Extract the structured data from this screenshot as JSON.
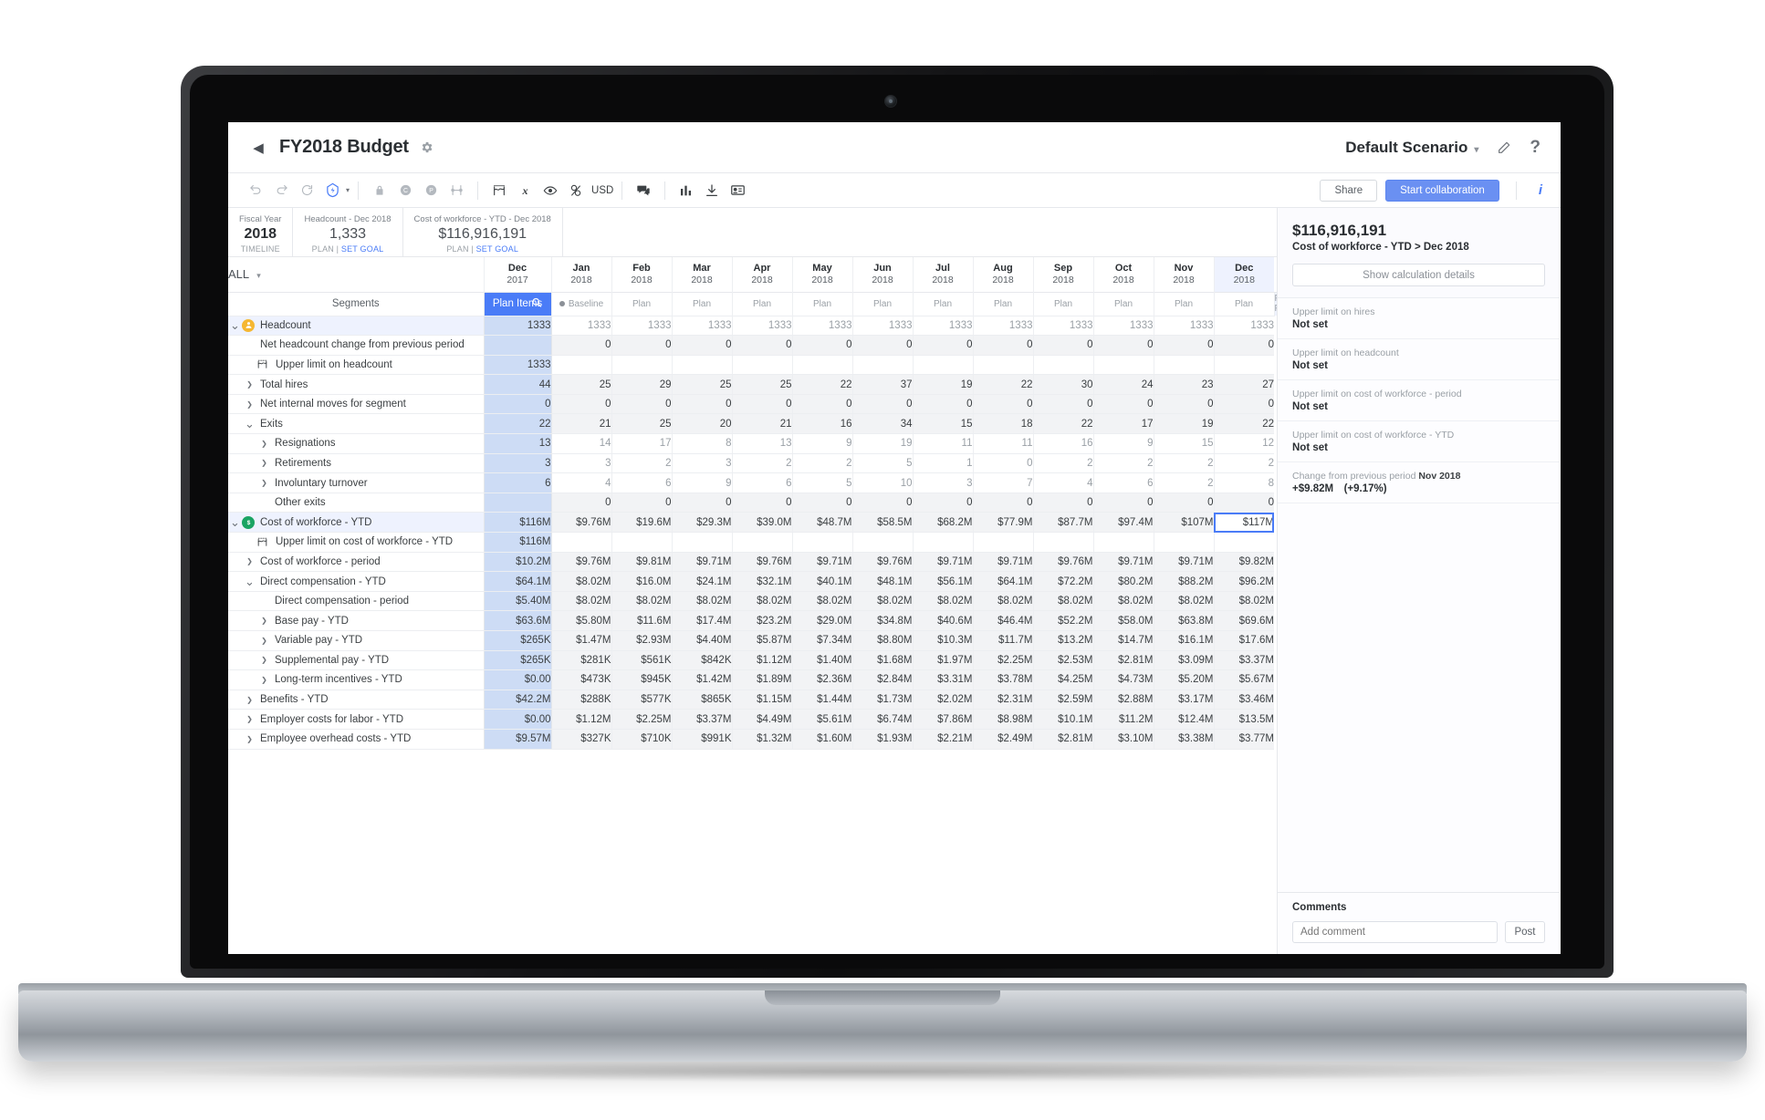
{
  "titlebar": {
    "back_icon": "back-caret-icon",
    "title": "FY2018 Budget",
    "gear_icon": "gear-icon",
    "scenario": "Default Scenario",
    "scenario_caret": "chevron-down-icon",
    "edit_icon": "pencil-icon",
    "help_icon": "?"
  },
  "toolbar": {
    "undo": "undo-icon",
    "redo": "redo-icon",
    "refresh": "refresh-icon",
    "bolt": "bolt-icon",
    "bolt_caret": "chevron-down-icon",
    "lock": "lock-icon",
    "copy": "copy-icon",
    "paste": "paste-icon",
    "distribute": "distribute-icon",
    "limit": "upper-limit-icon",
    "formula": "formula-icon",
    "eye": "eye-icon",
    "currency": "currency-icon",
    "currency_label": "USD",
    "comment": "comment-icon",
    "chart": "chart-icon",
    "download": "download-icon",
    "card": "card-view-icon",
    "share_label": "Share",
    "collab_label": "Start collaboration",
    "info_label": "i"
  },
  "kpis": [
    {
      "label": "Fiscal Year",
      "value": "2018",
      "sub": "TIMELINE",
      "bold": true,
      "link": ""
    },
    {
      "label": "Headcount - Dec 2018",
      "value": "1,333",
      "sub": "PLAN | ",
      "bold": false,
      "link": "SET GOAL"
    },
    {
      "label": "Cost of workforce - YTD - Dec 2018",
      "value": "$116,916,191",
      "sub": "PLAN | ",
      "bold": false,
      "link": "SET GOAL"
    }
  ],
  "grid": {
    "all_label": "ALL",
    "all_caret": "chevron-down-icon",
    "tab_segments": "Segments",
    "tab_plan_items": "Plan Items",
    "search_icon": "search-icon",
    "baseline_label": "Baseline",
    "columns": [
      {
        "month": "Dec",
        "year": "2017",
        "scenario": "Baseline",
        "selected": false,
        "baseline": true
      },
      {
        "month": "Jan",
        "year": "2018",
        "scenario": "Plan",
        "selected": false,
        "baseline": false
      },
      {
        "month": "Feb",
        "year": "2018",
        "scenario": "Plan",
        "selected": false,
        "baseline": false
      },
      {
        "month": "Mar",
        "year": "2018",
        "scenario": "Plan",
        "selected": false,
        "baseline": false
      },
      {
        "month": "Apr",
        "year": "2018",
        "scenario": "Plan",
        "selected": false,
        "baseline": false
      },
      {
        "month": "May",
        "year": "2018",
        "scenario": "Plan",
        "selected": false,
        "baseline": false
      },
      {
        "month": "Jun",
        "year": "2018",
        "scenario": "Plan",
        "selected": false,
        "baseline": false
      },
      {
        "month": "Jul",
        "year": "2018",
        "scenario": "Plan",
        "selected": false,
        "baseline": false
      },
      {
        "month": "Aug",
        "year": "2018",
        "scenario": "Plan",
        "selected": false,
        "baseline": false
      },
      {
        "month": "Sep",
        "year": "2018",
        "scenario": "Plan",
        "selected": false,
        "baseline": false
      },
      {
        "month": "Oct",
        "year": "2018",
        "scenario": "Plan",
        "selected": false,
        "baseline": false
      },
      {
        "month": "Nov",
        "year": "2018",
        "scenario": "Plan",
        "selected": false,
        "baseline": false
      },
      {
        "month": "Dec",
        "year": "2018",
        "scenario": "Plan FYE",
        "selected": true,
        "baseline": false
      }
    ],
    "rows": [
      {
        "label": "Headcount",
        "indent": 0,
        "twisty": "open",
        "icon": "headcount-icon",
        "highlight": true,
        "base": "1333",
        "cellstyle": "light",
        "values": [
          "1333",
          "1333",
          "1333",
          "1333",
          "1333",
          "1333",
          "1333",
          "1333",
          "1333",
          "1333",
          "1333",
          "1333"
        ]
      },
      {
        "label": "Net headcount change from previous period",
        "indent": 1,
        "twisty": "",
        "icon": "",
        "highlight": false,
        "base": "",
        "cellstyle": "data",
        "values": [
          "0",
          "0",
          "0",
          "0",
          "0",
          "0",
          "0",
          "0",
          "0",
          "0",
          "0",
          "0"
        ]
      },
      {
        "label": "Upper limit on headcount",
        "indent": 1,
        "twisty": "",
        "icon": "limit-icon",
        "highlight": false,
        "base": "1333",
        "cellstyle": "blank",
        "values": [
          "",
          "",
          "",
          "",
          "",
          "",
          "",
          "",
          "",
          "",
          "",
          ""
        ]
      },
      {
        "label": "Total hires",
        "indent": 1,
        "twisty": "closed",
        "icon": "",
        "highlight": false,
        "base": "44",
        "cellstyle": "data",
        "values": [
          "25",
          "29",
          "25",
          "25",
          "22",
          "37",
          "19",
          "22",
          "30",
          "24",
          "23",
          "27"
        ]
      },
      {
        "label": "Net internal moves for segment",
        "indent": 1,
        "twisty": "closed",
        "icon": "",
        "highlight": false,
        "base": "0",
        "cellstyle": "data",
        "values": [
          "0",
          "0",
          "0",
          "0",
          "0",
          "0",
          "0",
          "0",
          "0",
          "0",
          "0",
          "0"
        ]
      },
      {
        "label": "Exits",
        "indent": 1,
        "twisty": "open",
        "icon": "",
        "highlight": false,
        "base": "22",
        "cellstyle": "data",
        "values": [
          "21",
          "25",
          "20",
          "21",
          "16",
          "34",
          "15",
          "18",
          "22",
          "17",
          "19",
          "22"
        ]
      },
      {
        "label": "Resignations",
        "indent": 2,
        "twisty": "closed",
        "icon": "",
        "highlight": false,
        "base": "13",
        "cellstyle": "light",
        "values": [
          "14",
          "17",
          "8",
          "13",
          "9",
          "19",
          "11",
          "11",
          "16",
          "9",
          "15",
          "12"
        ]
      },
      {
        "label": "Retirements",
        "indent": 2,
        "twisty": "closed",
        "icon": "",
        "highlight": false,
        "base": "3",
        "cellstyle": "light",
        "values": [
          "3",
          "2",
          "3",
          "2",
          "2",
          "5",
          "1",
          "0",
          "2",
          "2",
          "2",
          "2"
        ]
      },
      {
        "label": "Involuntary turnover",
        "indent": 2,
        "twisty": "closed",
        "icon": "",
        "highlight": false,
        "base": "6",
        "cellstyle": "light",
        "values": [
          "4",
          "6",
          "9",
          "6",
          "5",
          "10",
          "3",
          "7",
          "4",
          "6",
          "2",
          "8"
        ]
      },
      {
        "label": "Other exits",
        "indent": 2,
        "twisty": "",
        "icon": "",
        "highlight": false,
        "base": "",
        "cellstyle": "data",
        "values": [
          "0",
          "0",
          "0",
          "0",
          "0",
          "0",
          "0",
          "0",
          "0",
          "0",
          "0",
          "0"
        ]
      },
      {
        "label": "Cost of workforce - YTD",
        "indent": 0,
        "twisty": "open",
        "icon": "cost-icon",
        "highlight": true,
        "base": "$116M",
        "cellstyle": "data",
        "cursor_last": true,
        "values": [
          "$9.76M",
          "$19.6M",
          "$29.3M",
          "$39.0M",
          "$48.7M",
          "$58.5M",
          "$68.2M",
          "$77.9M",
          "$87.7M",
          "$97.4M",
          "$107M",
          "$117M"
        ]
      },
      {
        "label": "Upper limit on cost of workforce - YTD",
        "indent": 1,
        "twisty": "",
        "icon": "limit-icon",
        "highlight": false,
        "base": "$116M",
        "cellstyle": "blank",
        "values": [
          "",
          "",
          "",
          "",
          "",
          "",
          "",
          "",
          "",
          "",
          "",
          ""
        ]
      },
      {
        "label": "Cost of workforce - period",
        "indent": 1,
        "twisty": "closed",
        "icon": "",
        "highlight": false,
        "base": "$10.2M",
        "cellstyle": "data",
        "values": [
          "$9.76M",
          "$9.81M",
          "$9.71M",
          "$9.76M",
          "$9.71M",
          "$9.76M",
          "$9.71M",
          "$9.71M",
          "$9.76M",
          "$9.71M",
          "$9.71M",
          "$9.82M"
        ]
      },
      {
        "label": "Direct compensation - YTD",
        "indent": 1,
        "twisty": "open",
        "icon": "",
        "highlight": false,
        "base": "$64.1M",
        "cellstyle": "data",
        "values": [
          "$8.02M",
          "$16.0M",
          "$24.1M",
          "$32.1M",
          "$40.1M",
          "$48.1M",
          "$56.1M",
          "$64.1M",
          "$72.2M",
          "$80.2M",
          "$88.2M",
          "$96.2M"
        ]
      },
      {
        "label": "Direct compensation - period",
        "indent": 2,
        "twisty": "",
        "icon": "",
        "highlight": false,
        "base": "$5.40M",
        "cellstyle": "data",
        "values": [
          "$8.02M",
          "$8.02M",
          "$8.02M",
          "$8.02M",
          "$8.02M",
          "$8.02M",
          "$8.02M",
          "$8.02M",
          "$8.02M",
          "$8.02M",
          "$8.02M",
          "$8.02M"
        ]
      },
      {
        "label": "Base pay - YTD",
        "indent": 2,
        "twisty": "closed",
        "icon": "",
        "highlight": false,
        "base": "$63.6M",
        "cellstyle": "data",
        "values": [
          "$5.80M",
          "$11.6M",
          "$17.4M",
          "$23.2M",
          "$29.0M",
          "$34.8M",
          "$40.6M",
          "$46.4M",
          "$52.2M",
          "$58.0M",
          "$63.8M",
          "$69.6M"
        ]
      },
      {
        "label": "Variable pay - YTD",
        "indent": 2,
        "twisty": "closed",
        "icon": "",
        "highlight": false,
        "base": "$265K",
        "cellstyle": "data",
        "values": [
          "$1.47M",
          "$2.93M",
          "$4.40M",
          "$5.87M",
          "$7.34M",
          "$8.80M",
          "$10.3M",
          "$11.7M",
          "$13.2M",
          "$14.7M",
          "$16.1M",
          "$17.6M"
        ]
      },
      {
        "label": "Supplemental pay - YTD",
        "indent": 2,
        "twisty": "closed",
        "icon": "",
        "highlight": false,
        "base": "$265K",
        "cellstyle": "data",
        "values": [
          "$281K",
          "$561K",
          "$842K",
          "$1.12M",
          "$1.40M",
          "$1.68M",
          "$1.97M",
          "$2.25M",
          "$2.53M",
          "$2.81M",
          "$3.09M",
          "$3.37M"
        ]
      },
      {
        "label": "Long-term incentives - YTD",
        "indent": 2,
        "twisty": "closed",
        "icon": "",
        "highlight": false,
        "base": "$0.00",
        "cellstyle": "data",
        "values": [
          "$473K",
          "$945K",
          "$1.42M",
          "$1.89M",
          "$2.36M",
          "$2.84M",
          "$3.31M",
          "$3.78M",
          "$4.25M",
          "$4.73M",
          "$5.20M",
          "$5.67M"
        ]
      },
      {
        "label": "Benefits - YTD",
        "indent": 1,
        "twisty": "closed",
        "icon": "",
        "highlight": false,
        "base": "$42.2M",
        "cellstyle": "data",
        "values": [
          "$288K",
          "$577K",
          "$865K",
          "$1.15M",
          "$1.44M",
          "$1.73M",
          "$2.02M",
          "$2.31M",
          "$2.59M",
          "$2.88M",
          "$3.17M",
          "$3.46M"
        ]
      },
      {
        "label": "Employer costs for labor - YTD",
        "indent": 1,
        "twisty": "closed",
        "icon": "",
        "highlight": false,
        "base": "$0.00",
        "cellstyle": "data",
        "values": [
          "$1.12M",
          "$2.25M",
          "$3.37M",
          "$4.49M",
          "$5.61M",
          "$6.74M",
          "$7.86M",
          "$8.98M",
          "$10.1M",
          "$11.2M",
          "$12.4M",
          "$13.5M"
        ]
      },
      {
        "label": "Employee overhead costs - YTD",
        "indent": 1,
        "twisty": "closed",
        "icon": "",
        "highlight": false,
        "base": "$9.57M",
        "cellstyle": "data",
        "values": [
          "$327K",
          "$710K",
          "$991K",
          "$1.32M",
          "$1.60M",
          "$1.93M",
          "$2.21M",
          "$2.49M",
          "$2.81M",
          "$3.10M",
          "$3.38M",
          "$3.77M"
        ]
      }
    ]
  },
  "details": {
    "amount": "$116,916,191",
    "subtitle": "Cost of workforce - YTD > Dec 2018",
    "calc_button": "Show calculation details",
    "items": [
      {
        "key": "Upper limit on hires",
        "value": "Not set"
      },
      {
        "key": "Upper limit on headcount",
        "value": "Not set"
      },
      {
        "key": "Upper limit on cost of workforce - period",
        "value": "Not set"
      },
      {
        "key": "Upper limit on cost of workforce - YTD",
        "value": "Not set"
      },
      {
        "key": "Change from previous period ",
        "key_bold": "Nov 2018",
        "value": "+$9.82M (+9.17%)"
      }
    ],
    "comments_title": "Comments",
    "comment_placeholder": "Add comment",
    "post_label": "Post"
  },
  "colors": {
    "accent": "#4a7cf7",
    "collab_button": "#6a90f2",
    "baseline_col": "#cddcf5",
    "row_highlight": "#eef2fe",
    "headcount_icon": "#f5b731",
    "cost_icon": "#1aa463"
  }
}
